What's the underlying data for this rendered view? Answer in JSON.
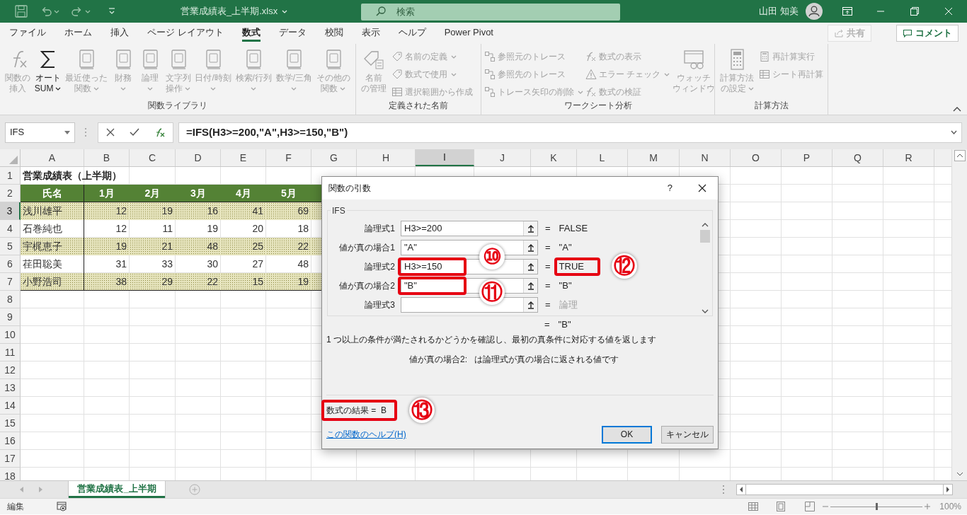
{
  "title_bar": {
    "file_name": "営業成績表_上半期.xlsx",
    "search": {
      "placeholder": "検索"
    },
    "user_name": "山田 知美"
  },
  "ribbon_tabs": [
    {
      "label": "ファイル",
      "selected": false
    },
    {
      "label": "ホーム",
      "selected": false
    },
    {
      "label": "挿入",
      "selected": false
    },
    {
      "label": "ページ レイアウト",
      "selected": false
    },
    {
      "label": "数式",
      "selected": true
    },
    {
      "label": "データ",
      "selected": false
    },
    {
      "label": "校閲",
      "selected": false
    },
    {
      "label": "表示",
      "selected": false
    },
    {
      "label": "ヘルプ",
      "selected": false
    },
    {
      "label": "Power Pivot",
      "selected": false
    }
  ],
  "share_button": {
    "label": "共有",
    "disabled": true
  },
  "comment_button": {
    "label": "コメント"
  },
  "ribbon_groups": [
    {
      "label": "関数ライブラリ",
      "items": [
        {
          "kind": "large",
          "lines": [
            "関数の",
            "挿入"
          ],
          "disabled": true,
          "dropdown": false
        },
        {
          "kind": "large",
          "lines": [
            "オート",
            "SUM"
          ],
          "disabled": false,
          "dropdown": true
        },
        {
          "kind": "large",
          "lines": [
            "最近使った",
            "関数"
          ],
          "disabled": true,
          "dropdown": true
        },
        {
          "kind": "large",
          "lines": [
            "財務"
          ],
          "disabled": true,
          "dropdown": true
        },
        {
          "kind": "large",
          "lines": [
            "論理"
          ],
          "disabled": true,
          "dropdown": true
        },
        {
          "kind": "large",
          "lines": [
            "文字列",
            "操作"
          ],
          "disabled": true,
          "dropdown": true
        },
        {
          "kind": "large",
          "lines": [
            "日付/時刻"
          ],
          "disabled": true,
          "dropdown": true
        },
        {
          "kind": "large",
          "lines": [
            "検索/行列"
          ],
          "disabled": true,
          "dropdown": true
        },
        {
          "kind": "large",
          "lines": [
            "数学/三角"
          ],
          "disabled": true,
          "dropdown": true
        },
        {
          "kind": "large",
          "lines": [
            "その他の",
            "関数"
          ],
          "disabled": true,
          "dropdown": true
        }
      ]
    },
    {
      "label": "定義された名前",
      "items": [
        {
          "kind": "large",
          "lines": [
            "名前",
            "の管理"
          ],
          "disabled": true,
          "dropdown": false
        },
        {
          "kind": "stack",
          "entries": [
            {
              "label": "名前の定義",
              "disabled": true,
              "dropdown": true
            },
            {
              "label": "数式で使用",
              "disabled": true,
              "dropdown": true
            },
            {
              "label": "選択範囲から作成",
              "disabled": true,
              "dropdown": false
            }
          ]
        }
      ]
    },
    {
      "label": "ワークシート分析",
      "items": [
        {
          "kind": "stack",
          "entries": [
            {
              "label": "参照元のトレース",
              "disabled": true,
              "dropdown": false
            },
            {
              "label": "参照先のトレース",
              "disabled": true,
              "dropdown": false
            },
            {
              "label": "トレース矢印の削除",
              "disabled": true,
              "dropdown": true
            }
          ]
        },
        {
          "kind": "stack",
          "entries": [
            {
              "label": "数式の表示",
              "disabled": true,
              "dropdown": false
            },
            {
              "label": "エラー チェック",
              "disabled": true,
              "dropdown": true
            },
            {
              "label": "数式の検証",
              "disabled": true,
              "dropdown": false
            }
          ]
        },
        {
          "kind": "large",
          "lines": [
            "ウォッチ",
            "ウィンドウ"
          ],
          "disabled": true,
          "dropdown": false
        }
      ]
    },
    {
      "label": "計算方法",
      "items": [
        {
          "kind": "large",
          "lines": [
            "計算方法",
            "の設定"
          ],
          "disabled": true,
          "dropdown": true
        },
        {
          "kind": "stack",
          "entries": [
            {
              "label": "再計算実行",
              "disabled": true,
              "dropdown": false
            },
            {
              "label": "シート再計算",
              "disabled": true,
              "dropdown": false
            }
          ]
        }
      ]
    }
  ],
  "formula_bar": {
    "name_box": "IFS",
    "formula": "=IFS(H3>=200,\"A\",H3>=150,\"B\")"
  },
  "sheet": {
    "columns": [
      {
        "label": "A",
        "selected": false
      },
      {
        "label": "B",
        "selected": false
      },
      {
        "label": "C",
        "selected": false
      },
      {
        "label": "D",
        "selected": false
      },
      {
        "label": "E",
        "selected": false
      },
      {
        "label": "F",
        "selected": false
      },
      {
        "label": "G",
        "selected": false
      },
      {
        "label": "H",
        "selected": false
      },
      {
        "label": "I",
        "selected": true
      },
      {
        "label": "J",
        "selected": false
      },
      {
        "label": "K",
        "selected": false
      },
      {
        "label": "L",
        "selected": false
      },
      {
        "label": "M",
        "selected": false
      },
      {
        "label": "N",
        "selected": false
      },
      {
        "label": "O",
        "selected": false
      },
      {
        "label": "P",
        "selected": false
      },
      {
        "label": "Q",
        "selected": false
      },
      {
        "label": "R",
        "selected": false
      }
    ],
    "rows": [
      {
        "label": "1",
        "selected": false
      },
      {
        "label": "2",
        "selected": false
      },
      {
        "label": "3",
        "selected": true
      },
      {
        "label": "4",
        "selected": false
      },
      {
        "label": "5",
        "selected": false
      },
      {
        "label": "6",
        "selected": false
      },
      {
        "label": "7",
        "selected": false
      },
      {
        "label": "8",
        "selected": false
      },
      {
        "label": "9",
        "selected": false
      },
      {
        "label": "10",
        "selected": false
      },
      {
        "label": "11",
        "selected": false
      },
      {
        "label": "12",
        "selected": false
      },
      {
        "label": "13",
        "selected": false
      },
      {
        "label": "14",
        "selected": false
      },
      {
        "label": "15",
        "selected": false
      },
      {
        "label": "16",
        "selected": false
      },
      {
        "label": "17",
        "selected": false
      },
      {
        "label": "18",
        "selected": false
      }
    ],
    "title_cell": "営業成績表（上半期）",
    "header_row": [
      "氏名",
      "1月",
      "2月",
      "3月",
      "4月",
      "5月"
    ],
    "records": [
      {
        "name": "浅川雄平",
        "values": [
          "12",
          "19",
          "16",
          "41",
          "69"
        ],
        "shaded": true
      },
      {
        "name": "石巻純也",
        "values": [
          "12",
          "11",
          "19",
          "20",
          "18"
        ],
        "shaded": false
      },
      {
        "name": "宇梶恵子",
        "values": [
          "19",
          "21",
          "48",
          "25",
          "22"
        ],
        "shaded": true
      },
      {
        "name": "荏田聡美",
        "values": [
          "31",
          "33",
          "30",
          "27",
          "48"
        ],
        "shaded": false
      },
      {
        "name": "小野浩司",
        "values": [
          "38",
          "29",
          "22",
          "15",
          "19"
        ],
        "shaded": true
      }
    ]
  },
  "dialog": {
    "title": "関数の引数",
    "help_button": "?",
    "function_name": "IFS",
    "arguments": [
      {
        "label": "論理式1",
        "value": "H3>=200",
        "equals": "=",
        "result": "FALSE",
        "result_muted": false,
        "value_highlighted": false,
        "result_highlighted": false
      },
      {
        "label": "値が真の場合1",
        "value": "\"A\"",
        "equals": "=",
        "result": "\"A\"",
        "result_muted": false,
        "value_highlighted": false,
        "result_highlighted": false
      },
      {
        "label": "論理式2",
        "value": "H3>=150",
        "equals": "=",
        "result": "TRUE",
        "result_muted": false,
        "value_highlighted": true,
        "value_callout": "⑩",
        "result_highlighted": true,
        "result_callout": "⑫"
      },
      {
        "label": "値が真の場合2",
        "value": "\"B\"",
        "equals": "=",
        "result": "\"B\"",
        "result_muted": false,
        "value_highlighted": true,
        "value_callout": "⑪",
        "result_highlighted": false
      },
      {
        "label": "論理式3",
        "equals": "=",
        "result": "論理",
        "result_muted": true,
        "value_highlighted": false,
        "result_highlighted": false
      }
    ],
    "overall_result": {
      "equals": "=",
      "value": "\"B\""
    },
    "description": "1 つ以上の条件が満たされるかどうかを確認し、最初の真条件に対応する値を返します",
    "argument_help": {
      "name": "値が真の場合2:",
      "text": "は論理式が真の場合に返される値です"
    },
    "result_line": {
      "text": "数式の結果 =  B",
      "highlighted": true,
      "callout": "⑬"
    },
    "help_link": "この関数のヘルプ(H)",
    "buttons": [
      {
        "label": "OK",
        "default": true
      },
      {
        "label": "キャンセル",
        "default": false
      }
    ]
  },
  "sheet_tabs": [
    {
      "label": "営業成績表_上半期",
      "selected": true
    }
  ],
  "status_bar": {
    "mode": "編集",
    "zoom": {
      "label": "100%",
      "level": 0.5
    }
  }
}
